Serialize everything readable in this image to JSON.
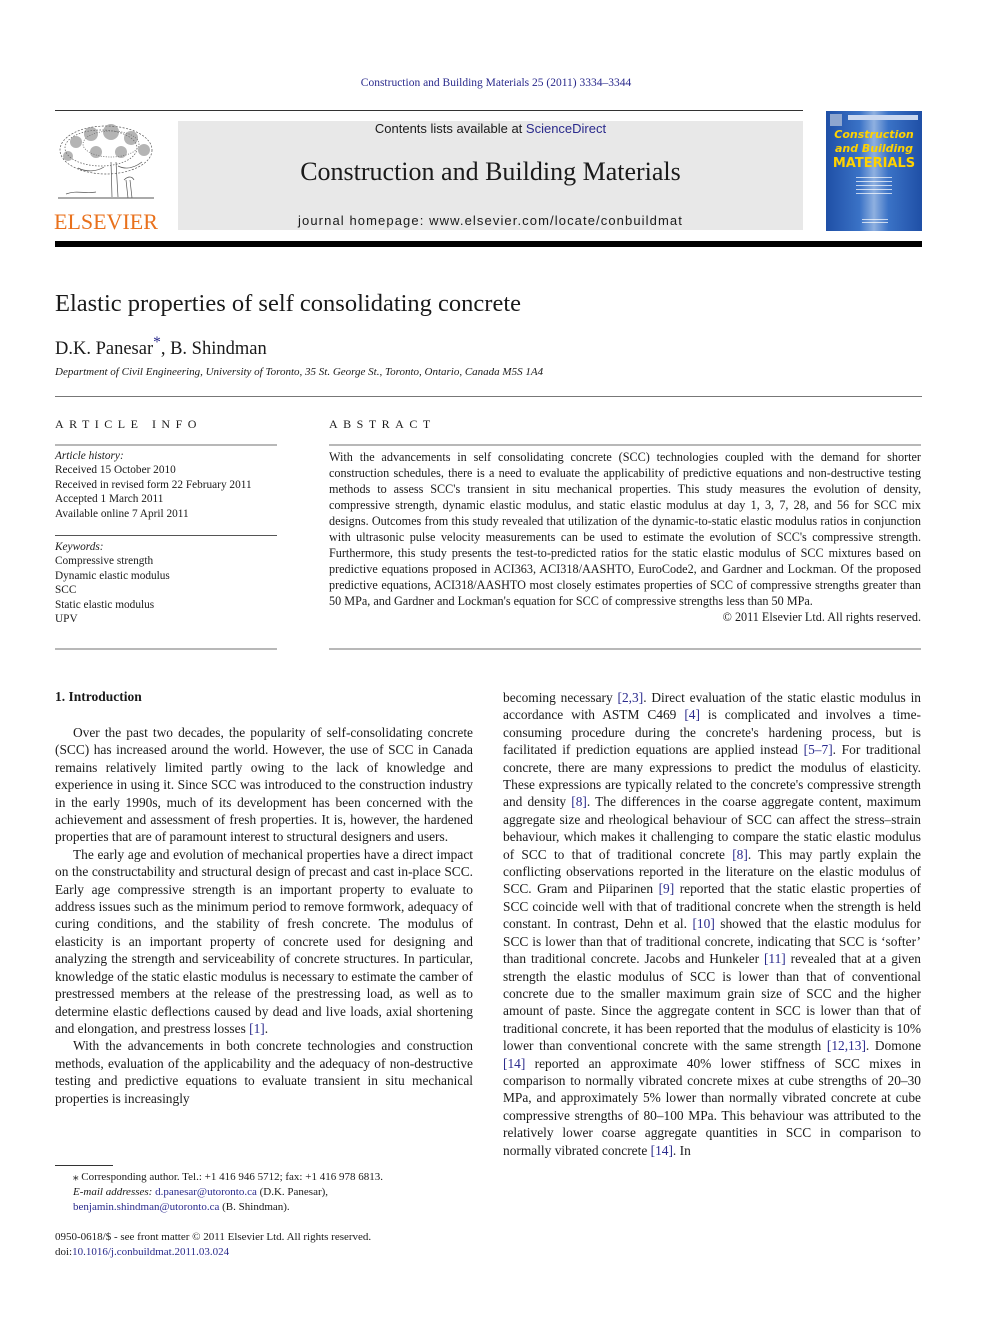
{
  "running_head": "Construction and Building Materials 25 (2011) 3334–3344",
  "masthead": {
    "publisher_wordmark": "ELSEVIER",
    "contents_prefix": "Contents lists available at ",
    "contents_link": "ScienceDirect",
    "journal_title": "Construction and Building Materials",
    "homepage": "journal homepage: www.elsevier.com/locate/conbuildmat",
    "cover": {
      "line1": "Construction",
      "line2": "and Building",
      "line3": "MATERIALS"
    }
  },
  "article": {
    "title": "Elastic properties of self consolidating concrete",
    "author1": "D.K. Panesar",
    "author1_mark": "*",
    "author_sep": ", ",
    "author2": "B. Shindman",
    "affiliation": "Department of Civil Engineering, University of Toronto, 35 St. George St., Toronto, Ontario, Canada M5S 1A4"
  },
  "article_info": {
    "heading": "ARTICLE INFO",
    "history_label": "Article history:",
    "history": [
      "Received 15 October 2010",
      "Received in revised form 22 February 2011",
      "Accepted 1 March 2011",
      "Available online 7 April 2011"
    ],
    "keywords_label": "Keywords:",
    "keywords": [
      "Compressive strength",
      "Dynamic elastic modulus",
      "SCC",
      "Static elastic modulus",
      "UPV"
    ]
  },
  "abstract": {
    "heading": "ABSTRACT",
    "text": "With the advancements in self consolidating concrete (SCC) technologies coupled with the demand for shorter construction schedules, there is a need to evaluate the applicability of predictive equations and non-destructive testing methods to assess SCC's transient in situ mechanical properties. This study mea­sures the evolution of density, compressive strength, dynamic elastic modulus, and static elastic modulus at day 1, 3, 7, 28, and 56 for SCC mix designs. Outcomes from this study revealed that utilization of the dynamic-to-static elastic modulus ratios in conjunction with ultrasonic pulse velocity measurements can be used to estimate the evolution of SCC's compressive strength. Furthermore, this study presents the test-to-predicted ratios for the static elastic modulus of SCC mixtures based on predictive equations pro­posed in ACI363, ACI318/AASHTO, EuroCode2, and Gardner and Lockman. Of the proposed predictive equations, ACI318/AASHTO most closely estimates properties of SCC of compressive strengths greater than 50 MPa, and Gardner and Lockman's equation for SCC of compressive strengths less than 50 MPa.",
    "copyright": "© 2011 Elsevier Ltd. All rights reserved."
  },
  "body": {
    "section_heading": "1. Introduction",
    "left_paragraphs": [
      {
        "text": "Over the past two decades, the popularity of self-consolidating concrete (SCC) has increased around the world. However, the use of SCC in Canada remains relatively limited partly owing to the lack of knowledge and experience in using it. Since SCC was introduced to the construction industry in the early 1990s, much of its devel­opment has been concerned with the achievement and assessment of fresh properties. It is, however, the hardened properties that are of paramount interest to structural designers and users."
      },
      {
        "text": "The early age and evolution of mechanical properties have a di­rect impact on the constructability and structural design of precast and cast in-place SCC. Early age compressive strength is an impor­tant property to evaluate to address issues such as the minimum period to remove formwork, adequacy of curing conditions, and the stability of fresh concrete. The modulus of elasticity is an impor­tant property of concrete used for designing and analyzing the strength and serviceability of concrete structures. In particular, knowledge of the static elastic modulus is necessary to estimate the camber of prestressed members at the release of the prestressing load, as well as to determine elastic deflections caused by dead and live loads, axial shortening and elongation, and prestress losses ",
        "cite": "[1]",
        "after": "."
      },
      {
        "text": "With the advancements in both concrete technologies and con­struction methods, evaluation of the applicability and the ade­quacy of non-destructive testing and predictive equations to evaluate transient in situ mechanical properties is increasingly"
      }
    ],
    "right_segments": [
      {
        "t": "becoming necessary "
      },
      {
        "c": "[2,3]"
      },
      {
        "t": ". Direct evaluation of the static elastic modulus in accordance with ASTM C469 "
      },
      {
        "c": "[4]"
      },
      {
        "t": " is complicated and in­volves a time-consuming procedure during the concrete's harden­ing process, but is facilitated if prediction equations are applied instead "
      },
      {
        "c": "[5–7]"
      },
      {
        "t": ". For traditional concrete, there are many expressions to predict the modulus of elasticity. These expressions are typically related to the concrete's compressive strength and density "
      },
      {
        "c": "[8]"
      },
      {
        "t": ". The differences in the coarse aggregate content, maximum aggregate size and rheological behaviour of SCC can affect the stress–strain behaviour, which makes it challenging to compare the static elastic modulus of SCC to that of traditional concrete "
      },
      {
        "c": "[8]"
      },
      {
        "t": ". This may partly explain the conflicting observations reported in the literature on the elastic modulus of SCC. Gram and Piiparinen "
      },
      {
        "c": "[9]"
      },
      {
        "t": " reported that the static elastic properties of SCC coincide well with that of tradi­tional concrete when the strength is held constant. In contrast, Dehn et al. "
      },
      {
        "c": "[10]"
      },
      {
        "t": " showed that the elastic modulus for SCC is lower than that of traditional concrete, indicating that SCC is ‘softer’ than traditional concrete. Jacobs and Hunkeler "
      },
      {
        "c": "[11]"
      },
      {
        "t": " revealed that at a gi­ven strength the elastic modulus of SCC is lower than that of con­ventional concrete due to the smaller maximum grain size of SCC and the higher amount of paste. Since the aggregate content in SCC is lower than that of traditional concrete, it has been reported that the modulus of elasticity is 10% lower than conventional con­crete with the same strength "
      },
      {
        "c": "[12,13]"
      },
      {
        "t": ". Domone "
      },
      {
        "c": "[14]"
      },
      {
        "t": " reported an approximate 40% lower stiffness of SCC mixes in comparison to normally vibrated concrete mixes at cube strengths of 20–30 MPa, and approximately 5% lower than normally vibrated con­crete at cube compressive strengths of 80–100 MPa. This behaviour was attributed to the relatively lower coarse aggregate quantities in SCC in comparison to normally vibrated concrete "
      },
      {
        "c": "[14]"
      },
      {
        "t": ". In"
      }
    ]
  },
  "footnotes": {
    "corresponding": "⁎ Corresponding author. Tel.: +1 416 946 5712; fax: +1 416 978 6813.",
    "email_label": "E-mail addresses:",
    "email1": "d.panesar@utoronto.ca",
    "email1_name": " (D.K. Panesar), ",
    "email2": "benjamin.shindman@utoronto.ca",
    "email2_name": " (B. Shindman)."
  },
  "legal": {
    "issn_line": "0950-0618/$ - see front matter © 2011 Elsevier Ltd. All rights reserved.",
    "doi_prefix": "doi:",
    "doi": "10.1016/j.conbuildmat.2011.03.024"
  }
}
